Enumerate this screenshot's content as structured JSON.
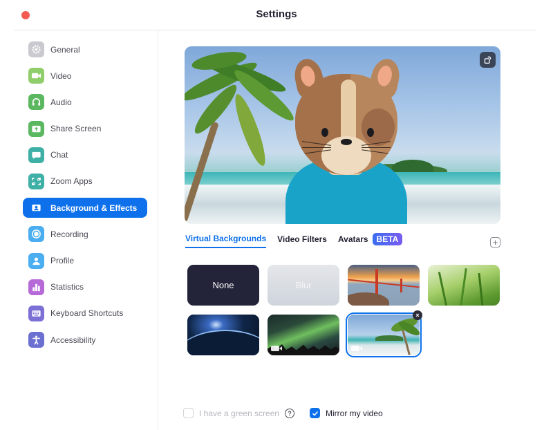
{
  "window": {
    "title": "Settings"
  },
  "sidebar": {
    "items": [
      {
        "label": "General",
        "icon": "gear-icon",
        "color": "#c9c9cf",
        "active": false
      },
      {
        "label": "Video",
        "icon": "video-camera-icon",
        "color": "#8fce6a",
        "active": false
      },
      {
        "label": "Audio",
        "icon": "headphones-icon",
        "color": "#5cb860",
        "active": false
      },
      {
        "label": "Share Screen",
        "icon": "share-screen-icon",
        "color": "#5cb860",
        "active": false
      },
      {
        "label": "Chat",
        "icon": "chat-bubble-icon",
        "color": "#3fb0a6",
        "active": false
      },
      {
        "label": "Zoom Apps",
        "icon": "apps-icon",
        "color": "#3fb0a6",
        "active": false
      },
      {
        "label": "Background & Effects",
        "icon": "person-card-icon",
        "color": "#0e71eb",
        "active": true
      },
      {
        "label": "Recording",
        "icon": "record-icon",
        "color": "#4aaef0",
        "active": false
      },
      {
        "label": "Profile",
        "icon": "user-icon",
        "color": "#4aaef0",
        "active": false
      },
      {
        "label": "Statistics",
        "icon": "bar-chart-icon",
        "color": "#b66ad8",
        "active": false
      },
      {
        "label": "Keyboard Shortcuts",
        "icon": "keyboard-icon",
        "color": "#7c6fd6",
        "active": false
      },
      {
        "label": "Accessibility",
        "icon": "accessibility-icon",
        "color": "#6a6fd0",
        "active": false
      }
    ]
  },
  "preview": {
    "rotate_icon": "rotate-camera-icon"
  },
  "tabs": [
    {
      "label": "Virtual Backgrounds",
      "active": true
    },
    {
      "label": "Video Filters",
      "active": false
    },
    {
      "label": "Avatars",
      "active": false,
      "badge": "BETA"
    }
  ],
  "add_button": {
    "label": "+"
  },
  "backgrounds": [
    {
      "label": "None",
      "name": "none",
      "video": false,
      "selected": false
    },
    {
      "label": "Blur",
      "name": "blur",
      "video": false,
      "selected": false
    },
    {
      "label": "",
      "name": "golden-gate-bridge",
      "video": false,
      "selected": false
    },
    {
      "label": "",
      "name": "grass",
      "video": false,
      "selected": false
    },
    {
      "label": "",
      "name": "earth-from-space",
      "video": false,
      "selected": false
    },
    {
      "label": "",
      "name": "aurora",
      "video": true,
      "selected": false
    },
    {
      "label": "",
      "name": "beach",
      "video": true,
      "selected": true
    }
  ],
  "remove_button": {
    "label": "×"
  },
  "options": {
    "green_screen": {
      "label": "I have a green screen",
      "checked": false,
      "disabled": true,
      "help": "?"
    },
    "mirror": {
      "label": "Mirror my video",
      "checked": true
    }
  },
  "colors": {
    "accent": "#0e71eb",
    "close": "#f25a52"
  }
}
